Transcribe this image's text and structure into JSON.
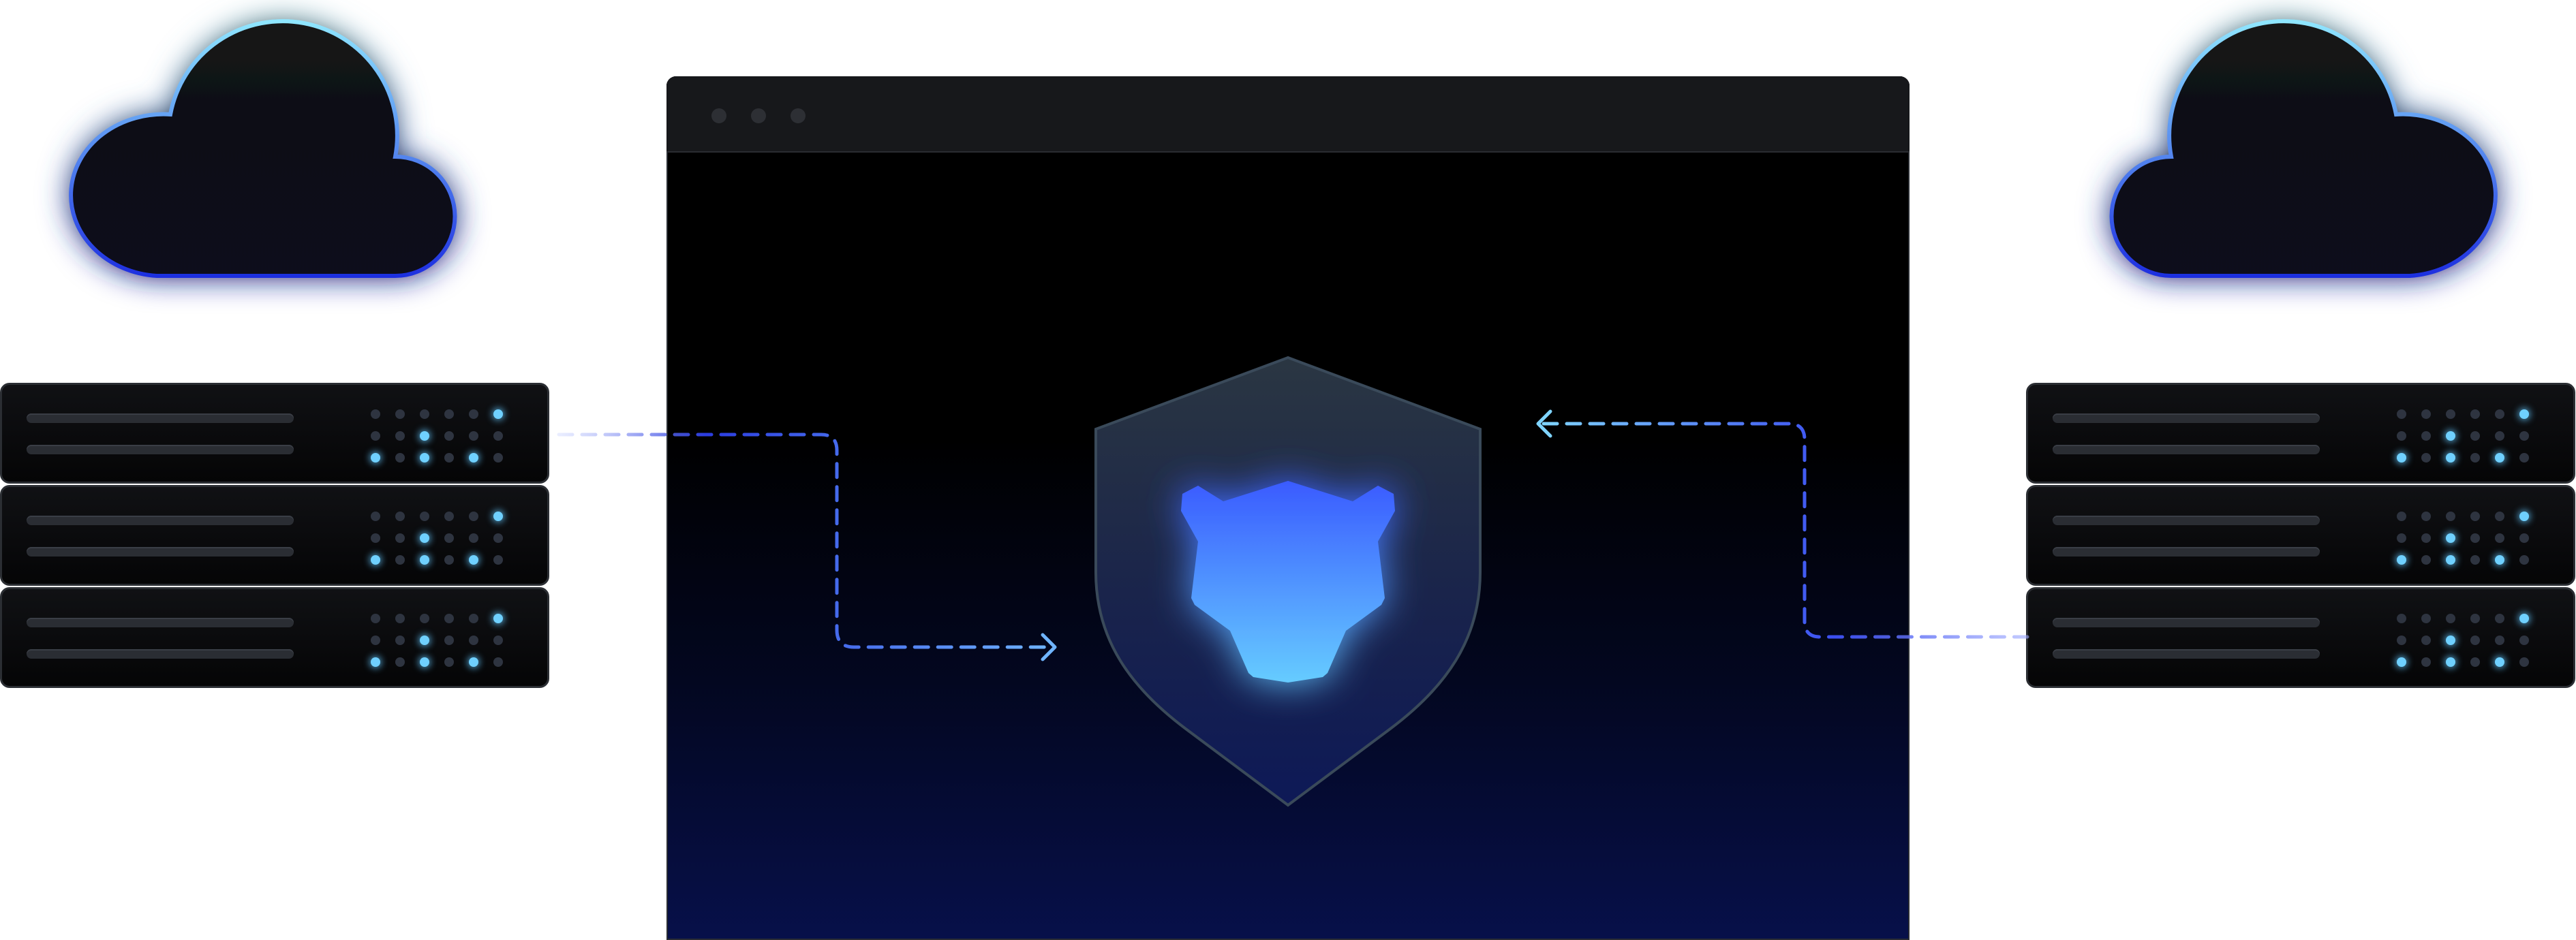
{
  "scene": {
    "left_group": {
      "cloud_icon": "cloud-icon",
      "servers": [
        {
          "leds": [
            [
              0,
              0,
              0,
              0,
              0,
              1
            ],
            [
              0,
              0,
              1,
              0,
              0,
              0
            ],
            [
              1,
              0,
              1,
              0,
              1,
              0
            ]
          ]
        },
        {
          "leds": [
            [
              0,
              0,
              0,
              0,
              0,
              1
            ],
            [
              0,
              0,
              1,
              0,
              0,
              0
            ],
            [
              1,
              0,
              1,
              0,
              1,
              0
            ]
          ]
        },
        {
          "leds": [
            [
              0,
              0,
              0,
              0,
              0,
              1
            ],
            [
              0,
              0,
              1,
              0,
              0,
              0
            ],
            [
              1,
              0,
              1,
              0,
              1,
              0
            ]
          ]
        }
      ]
    },
    "right_group": {
      "cloud_icon": "cloud-icon",
      "servers": [
        {
          "leds": [
            [
              0,
              0,
              0,
              0,
              0,
              1
            ],
            [
              0,
              0,
              1,
              0,
              0,
              0
            ],
            [
              1,
              0,
              1,
              0,
              1,
              0
            ]
          ]
        },
        {
          "leds": [
            [
              0,
              0,
              0,
              0,
              0,
              1
            ],
            [
              0,
              0,
              1,
              0,
              0,
              0
            ],
            [
              1,
              0,
              1,
              0,
              1,
              0
            ]
          ]
        },
        {
          "leds": [
            [
              0,
              0,
              0,
              0,
              0,
              1
            ],
            [
              0,
              0,
              1,
              0,
              0,
              0
            ],
            [
              1,
              0,
              1,
              0,
              1,
              0
            ]
          ]
        }
      ]
    },
    "center": {
      "shield_icon": "shield-icon",
      "logo_icon": "leopard-head-icon"
    },
    "flows": [
      "left-server-to-shield",
      "right-server-to-shield"
    ],
    "colors": {
      "accent_blue": "#3d63ff",
      "accent_cyan": "#6fd0ff",
      "deep_navy": "#07104a",
      "window_bar": "#17181b"
    }
  }
}
